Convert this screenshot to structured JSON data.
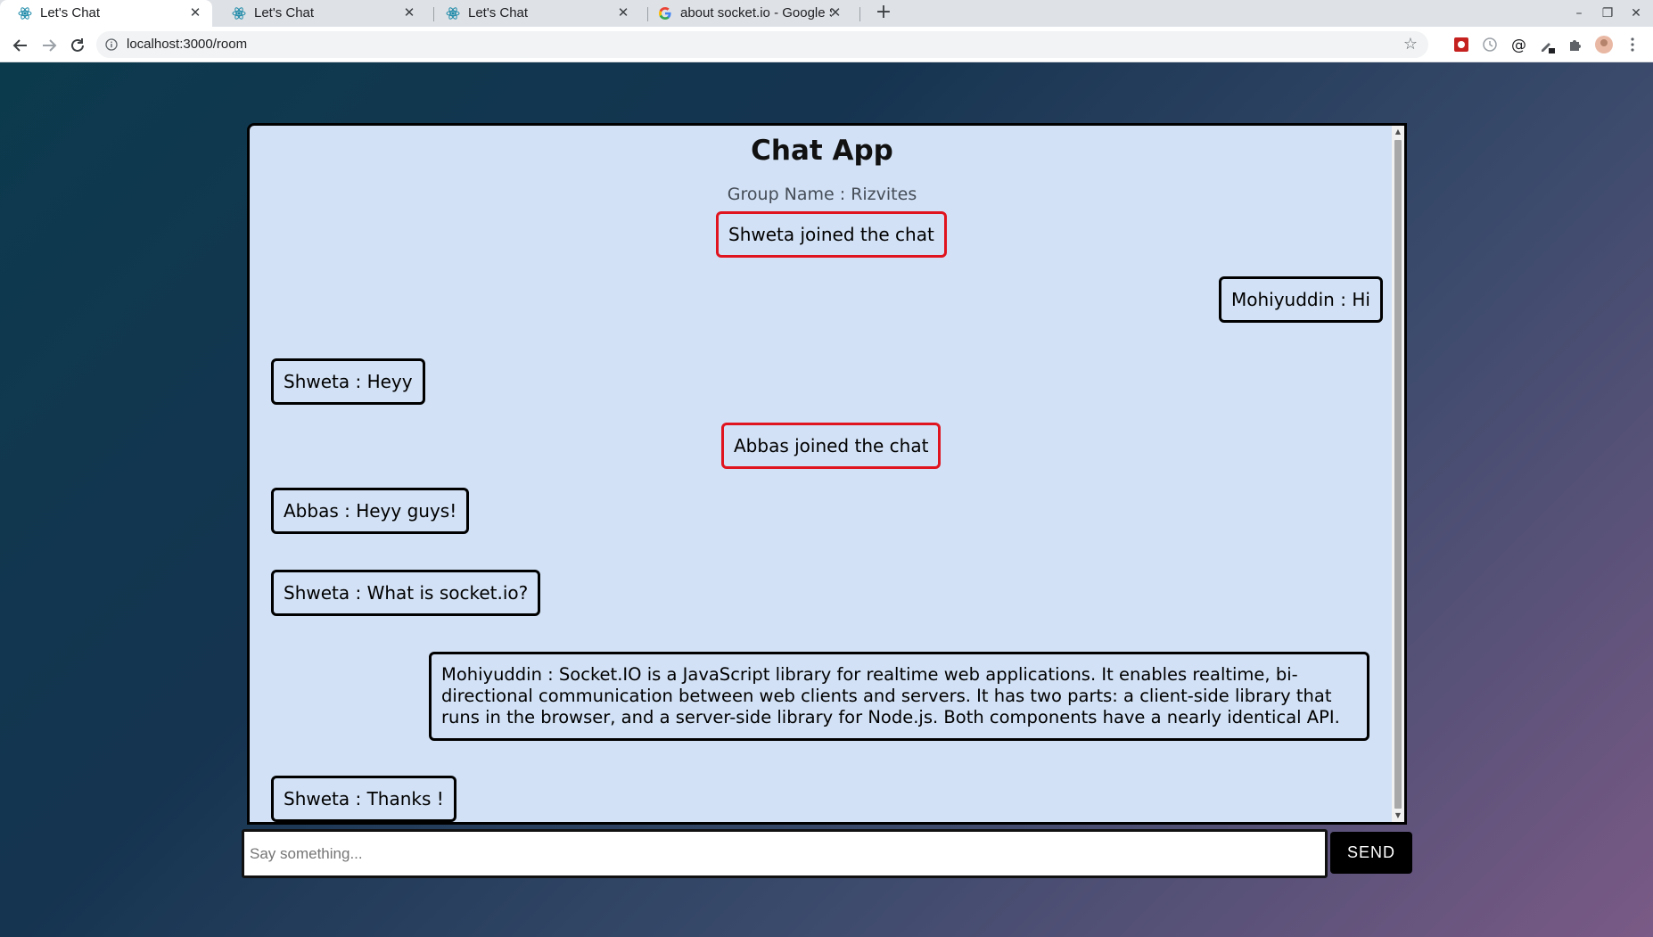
{
  "browser": {
    "tabs": [
      {
        "title": "Let's Chat",
        "icon": "react-icon",
        "active": true
      },
      {
        "title": "Let's Chat",
        "icon": "react-icon",
        "active": false
      },
      {
        "title": "Let's Chat",
        "icon": "react-icon",
        "active": false
      },
      {
        "title": "about socket.io - Google S",
        "icon": "google-icon",
        "active": false
      }
    ],
    "url": "localhost:3000/room"
  },
  "chat": {
    "title": "Chat App",
    "group_name": "Group Name : Rizvites",
    "messages": [
      {
        "type": "system",
        "text": "Shweta joined the chat"
      },
      {
        "type": "self",
        "text": "Mohiyuddin : Hi"
      },
      {
        "type": "other",
        "text": "Shweta : Heyy"
      },
      {
        "type": "system",
        "text": "Abbas joined the chat"
      },
      {
        "type": "other",
        "text": "Abbas : Heyy guys!"
      },
      {
        "type": "other",
        "text": "Shweta : What is socket.io?"
      },
      {
        "type": "self",
        "text": "Mohiyuddin : Socket.IO is a JavaScript library for realtime web applications. It enables realtime, bi-directional communication between web clients and servers. It has two parts: a client-side library that runs in the browser, and a server-side library for Node.js. Both components have a nearly identical API."
      },
      {
        "type": "other",
        "text": "Shweta : Thanks !"
      }
    ]
  },
  "composer": {
    "placeholder": "Say something...",
    "value": "",
    "send_label": "SEND"
  },
  "colors": {
    "system_border": "#e0141f",
    "bubble_border": "#000000",
    "panel_bg": "#d2e1f5"
  }
}
